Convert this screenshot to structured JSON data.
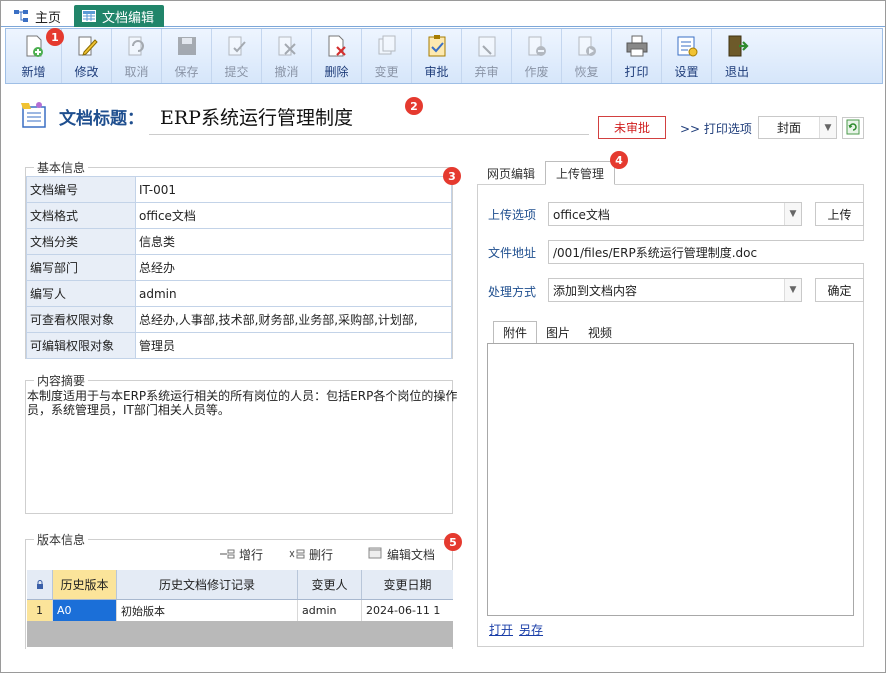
{
  "tabs": {
    "home_label": "主页",
    "doc_label": "文档编辑"
  },
  "toolbar": {
    "buttons": [
      {
        "label": "新增",
        "enabled": true,
        "icon": "new-doc-icon"
      },
      {
        "label": "修改",
        "enabled": true,
        "icon": "edit-icon"
      },
      {
        "label": "取消",
        "enabled": false,
        "icon": "undo-icon"
      },
      {
        "label": "保存",
        "enabled": false,
        "icon": "save-icon"
      },
      {
        "label": "提交",
        "enabled": false,
        "icon": "submit-icon"
      },
      {
        "label": "撤消",
        "enabled": false,
        "icon": "revoke-icon"
      },
      {
        "label": "删除",
        "enabled": true,
        "icon": "delete-icon"
      },
      {
        "label": "变更",
        "enabled": false,
        "icon": "change-icon"
      },
      {
        "label": "审批",
        "enabled": true,
        "icon": "approve-icon"
      },
      {
        "label": "弃审",
        "enabled": false,
        "icon": "unapprove-icon"
      },
      {
        "label": "作废",
        "enabled": false,
        "icon": "void-icon"
      },
      {
        "label": "恢复",
        "enabled": false,
        "icon": "restore-icon"
      },
      {
        "label": "打印",
        "enabled": true,
        "icon": "print-icon"
      },
      {
        "label": "设置",
        "enabled": true,
        "icon": "settings-icon"
      },
      {
        "label": "退出",
        "enabled": true,
        "icon": "exit-icon"
      }
    ]
  },
  "badges": {
    "b1": "1",
    "b2": "2",
    "b3": "3",
    "b4": "4",
    "b5": "5"
  },
  "header": {
    "title_label": "文档标题：",
    "title_value": "ERP系统运行管理制度",
    "status": "未审批",
    "print_options": ">> 打印选项",
    "cover_select": "封面"
  },
  "basic_info": {
    "legend": "基本信息",
    "rows": [
      {
        "k": "文档编号",
        "v": "IT-001"
      },
      {
        "k": "文档格式",
        "v": "office文档"
      },
      {
        "k": "文档分类",
        "v": "信息类"
      },
      {
        "k": "编写部门",
        "v": "总经办"
      },
      {
        "k": "编写人",
        "v": "admin"
      },
      {
        "k": "可查看权限对象",
        "v": "总经办,人事部,技术部,财务部,业务部,采购部,计划部,"
      },
      {
        "k": "可编辑权限对象",
        "v": "管理员"
      }
    ]
  },
  "summary": {
    "legend": "内容摘要",
    "text": "本制度适用于与本ERP系统运行相关的所有岗位的人员：包括ERP各个岗位的操作员，系统管理员，IT部门相关人员等。"
  },
  "version": {
    "legend": "版本信息",
    "add_row": "增行",
    "delete_row": "删行",
    "edit_doc": "编辑文档",
    "columns": [
      "历史版本",
      "历史文档修订记录",
      "变更人",
      "变更日期"
    ],
    "rows": [
      {
        "num": "1",
        "ver": "A0",
        "record": "初始版本",
        "user": "admin",
        "date": "2024-06-11 1"
      }
    ]
  },
  "right": {
    "tab_web": "网页编辑",
    "tab_upload": "上传管理",
    "upload_option_label": "上传选项",
    "upload_option_value": "office文档",
    "upload_button": "上传",
    "file_address_label": "文件地址",
    "file_address_value": "/001/files/ERP系统运行管理制度.doc",
    "process_label": "处理方式",
    "process_value": "添加到文档内容",
    "confirm_button": "确定",
    "inner_tabs": [
      "附件",
      "图片",
      "视频"
    ],
    "open_link": "打开",
    "save_as_link": "另存"
  }
}
